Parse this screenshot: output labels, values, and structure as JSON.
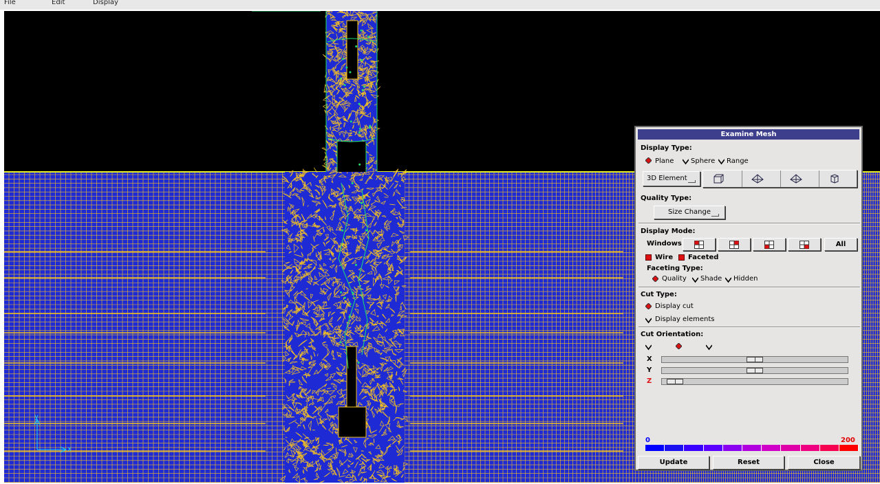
{
  "menubar": {
    "items": [
      "File",
      "Edit",
      "Display"
    ]
  },
  "panel": {
    "title": "Examine Mesh",
    "display_type": {
      "label": "Display Type:",
      "options": [
        {
          "label": "Plane",
          "selected": true
        },
        {
          "label": "Sphere",
          "selected": false
        },
        {
          "label": "Range",
          "selected": false
        }
      ],
      "element_menu": "3D Element",
      "shape_icons": [
        "hexahedron-icon",
        "pyramid-icon",
        "wedge-icon",
        "tetrahedron-icon"
      ]
    },
    "quality_type": {
      "label": "Quality Type:",
      "menu_value": "Size Change"
    },
    "display_mode": {
      "label": "Display Mode:",
      "windows_label": "Windows",
      "window_buttons": [
        "window-top-left-icon",
        "window-top-right-icon",
        "window-bottom-left-icon",
        "window-bottom-right-icon"
      ],
      "all_label": "All",
      "wire_label": "Wire",
      "faceted_label": "Faceted",
      "faceting_label": "Faceting Type:",
      "faceting_options": [
        {
          "label": "Quality",
          "selected": true
        },
        {
          "label": "Shade",
          "selected": false
        },
        {
          "label": "Hidden",
          "selected": false
        }
      ]
    },
    "cut_type": {
      "label": "Cut Type:",
      "options": [
        {
          "label": "Display cut",
          "selected": true
        },
        {
          "label": "Display elements",
          "selected": false
        }
      ]
    },
    "cut_orientation": {
      "label": "Cut Orientation:",
      "sliders": [
        {
          "axis": "X",
          "value": 0.5
        },
        {
          "axis": "Y",
          "value": 0.5
        },
        {
          "axis": "Z",
          "value": 0.03
        }
      ]
    },
    "colorbar": {
      "min_label": "0",
      "max_label": "200",
      "colors": [
        "#0000ff",
        "#1a10f0",
        "#3a00ff",
        "#5a00ff",
        "#8a00f0",
        "#b000e0",
        "#d000c8",
        "#e000a8",
        "#ee0080",
        "#f60050",
        "#ff0000"
      ]
    },
    "buttons": {
      "update": "Update",
      "reset": "Reset",
      "close": "Close"
    }
  },
  "viewport": {
    "axis_y": "y",
    "axis_x": "x",
    "colors": {
      "background": "#000000",
      "fill": "#1e2bd4",
      "mesh": "#f4c020",
      "edges": "#18d0ff"
    }
  }
}
